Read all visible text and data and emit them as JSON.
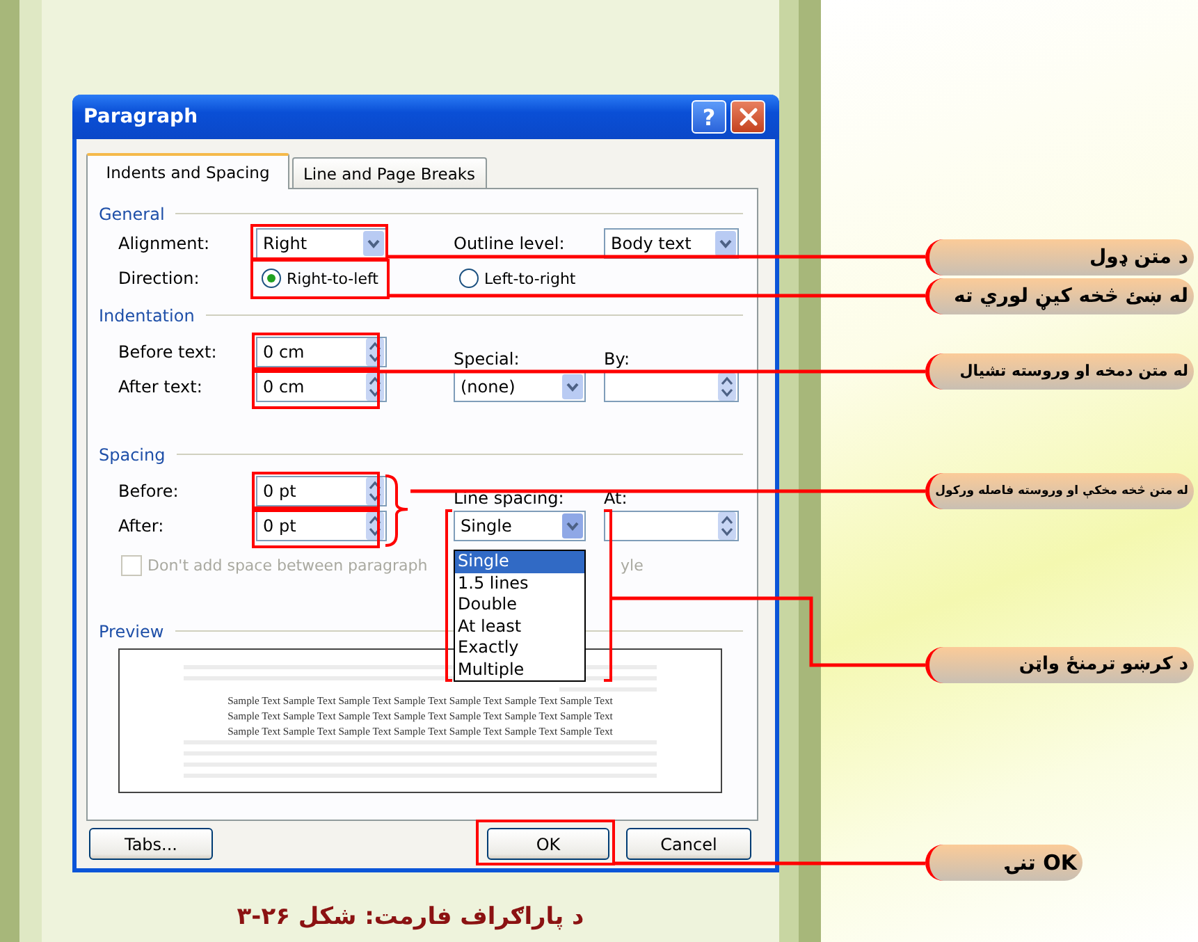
{
  "dialog": {
    "title": "Paragraph",
    "help_button": "?",
    "tabs": [
      {
        "label": "Indents and Spacing",
        "selected": true
      },
      {
        "label": "Line and Page Breaks",
        "selected": false
      }
    ],
    "general": {
      "heading": "General",
      "alignment": {
        "label": "Alignment:",
        "value": "Right"
      },
      "outline_level": {
        "label": "Outline level:",
        "value": "Body text"
      },
      "direction": {
        "label": "Direction:",
        "options": [
          {
            "label": "Right-to-left",
            "selected": true
          },
          {
            "label": "Left-to-right",
            "selected": false
          }
        ]
      }
    },
    "indentation": {
      "heading": "Indentation",
      "before_text": {
        "label": "Before text:",
        "value": "0 cm"
      },
      "after_text": {
        "label": "After text:",
        "value": "0 cm"
      },
      "special": {
        "label": "Special:",
        "value": "(none)"
      },
      "by": {
        "label": "By:"
      }
    },
    "spacing": {
      "heading": "Spacing",
      "before": {
        "label": "Before:",
        "value": "0 pt"
      },
      "after": {
        "label": "After:",
        "value": "0 pt"
      },
      "line_spacing": {
        "label": "Line spacing:",
        "value": "Single",
        "options": [
          {
            "label": "Single",
            "selected": true
          },
          {
            "label": "1.5 lines",
            "selected": false
          },
          {
            "label": "Double",
            "selected": false
          },
          {
            "label": "At least",
            "selected": false
          },
          {
            "label": "Exactly",
            "selected": false
          },
          {
            "label": "Multiple",
            "selected": false
          }
        ]
      },
      "at": {
        "label": "At:"
      },
      "no_space_checkbox": {
        "label": "Don't add space between paragraph",
        "label_tail": "yle",
        "checked": false,
        "disabled": true
      }
    },
    "preview": {
      "heading": "Preview",
      "sample_lines": [
        "Sample Text Sample Text Sample Text Sample Text Sample Text Sample Text Sample Text",
        "Sample Text Sample Text Sample Text Sample Text Sample Text Sample Text Sample Text",
        "Sample Text Sample Text Sample Text Sample Text Sample Text Sample Text Sample Text"
      ]
    },
    "buttons": [
      {
        "label": "Tabs..."
      },
      {
        "label": "OK"
      },
      {
        "label": "Cancel"
      }
    ]
  },
  "annotations": [
    {
      "text": "د متن ډول"
    },
    {
      "text": "له ښئ څخه کيڼ لوري ته"
    },
    {
      "text": "له متن دمخه او وروسته تشيال"
    },
    {
      "text": "له متن څخه مخکې او وروسته فاصله ورکول"
    },
    {
      "text": "د کرښو ترمنځ واټن"
    },
    {
      "text": "OK تنۍ"
    }
  ],
  "caption": "د پاراګراف فارمت: شکل ۲۶-۳"
}
